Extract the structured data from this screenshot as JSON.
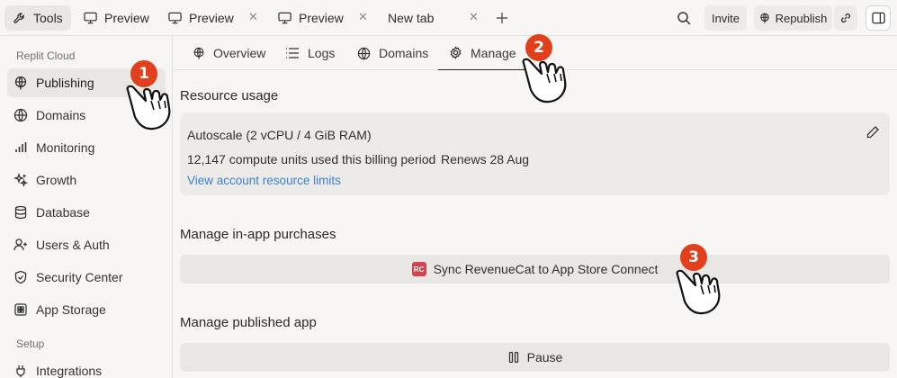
{
  "topbar": {
    "tools_label": "Tools",
    "tabs": [
      {
        "label": "Preview"
      },
      {
        "label": "Preview"
      },
      {
        "label": "Preview"
      },
      {
        "label": "New tab"
      }
    ],
    "close_glyph": "✕",
    "invite_label": "Invite",
    "republish_label": "Republish"
  },
  "sidebar": {
    "section_replit": "Replit Cloud",
    "items": [
      {
        "label": "Publishing",
        "icon": "publish-icon"
      },
      {
        "label": "Domains",
        "icon": "globe-icon"
      },
      {
        "label": "Monitoring",
        "icon": "monitoring-icon"
      },
      {
        "label": "Growth",
        "icon": "growth-icon"
      },
      {
        "label": "Database",
        "icon": "database-icon"
      },
      {
        "label": "Users & Auth",
        "icon": "users-icon"
      },
      {
        "label": "Security Center",
        "icon": "shield-icon"
      },
      {
        "label": "App Storage",
        "icon": "storage-icon"
      }
    ],
    "section_setup": "Setup",
    "setup_items": [
      {
        "label": "Integrations",
        "icon": "integrations-icon"
      }
    ]
  },
  "subtabs": [
    {
      "label": "Overview"
    },
    {
      "label": "Logs"
    },
    {
      "label": "Domains"
    },
    {
      "label": "Manage"
    }
  ],
  "resource": {
    "heading": "Resource usage",
    "plan": "Autoscale (2 vCPU / 4 GiB RAM)",
    "usage": "12,147 compute units used this billing period",
    "renews": "Renews 28 Aug",
    "link": "View account resource limits"
  },
  "purchases": {
    "heading": "Manage in-app purchases",
    "button": "Sync RevenueCat to App Store Connect",
    "icon_text": "RC"
  },
  "published": {
    "heading": "Manage published app",
    "pause_button": "Pause"
  },
  "steps": [
    "1",
    "2",
    "3"
  ],
  "colors": {
    "accent_link": "#3b82d6",
    "step_badge": "#e2401c",
    "revenuecat": "#d6424c"
  }
}
